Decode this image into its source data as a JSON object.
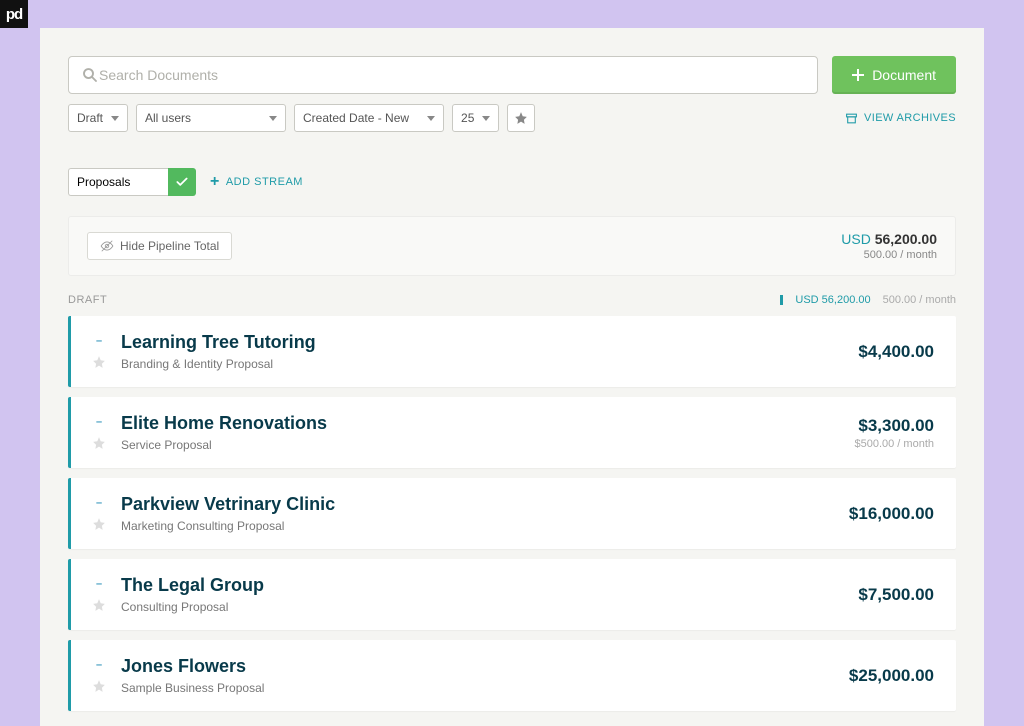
{
  "badge": "pd",
  "search": {
    "placeholder": "Search Documents"
  },
  "new_doc_label": "Document",
  "filters": {
    "status": "Draft",
    "users": "All users",
    "sort": "Created Date - New",
    "count": "25"
  },
  "archives_label": "VIEW ARCHIVES",
  "stream": {
    "input": "Proposals",
    "add_label": "ADD STREAM"
  },
  "pipeline": {
    "hide_label": "Hide Pipeline Total",
    "currency": "USD",
    "total": "56,200.00",
    "recurring": "500.00 / month"
  },
  "status_header": {
    "label": "DRAFT",
    "amount": "USD 56,200.00",
    "recurring": "500.00 / month"
  },
  "documents": [
    {
      "title": "Learning Tree Tutoring",
      "subtitle": "Branding & Identity Proposal",
      "amount": "$4,400.00",
      "recurring": ""
    },
    {
      "title": "Elite Home Renovations",
      "subtitle": "Service Proposal",
      "amount": "$3,300.00",
      "recurring": "$500.00 / month"
    },
    {
      "title": "Parkview Vetrinary Clinic",
      "subtitle": "Marketing Consulting Proposal",
      "amount": "$16,000.00",
      "recurring": ""
    },
    {
      "title": "The Legal Group",
      "subtitle": "Consulting Proposal",
      "amount": "$7,500.00",
      "recurring": ""
    },
    {
      "title": "Jones Flowers",
      "subtitle": "Sample Business Proposal",
      "amount": "$25,000.00",
      "recurring": ""
    }
  ]
}
